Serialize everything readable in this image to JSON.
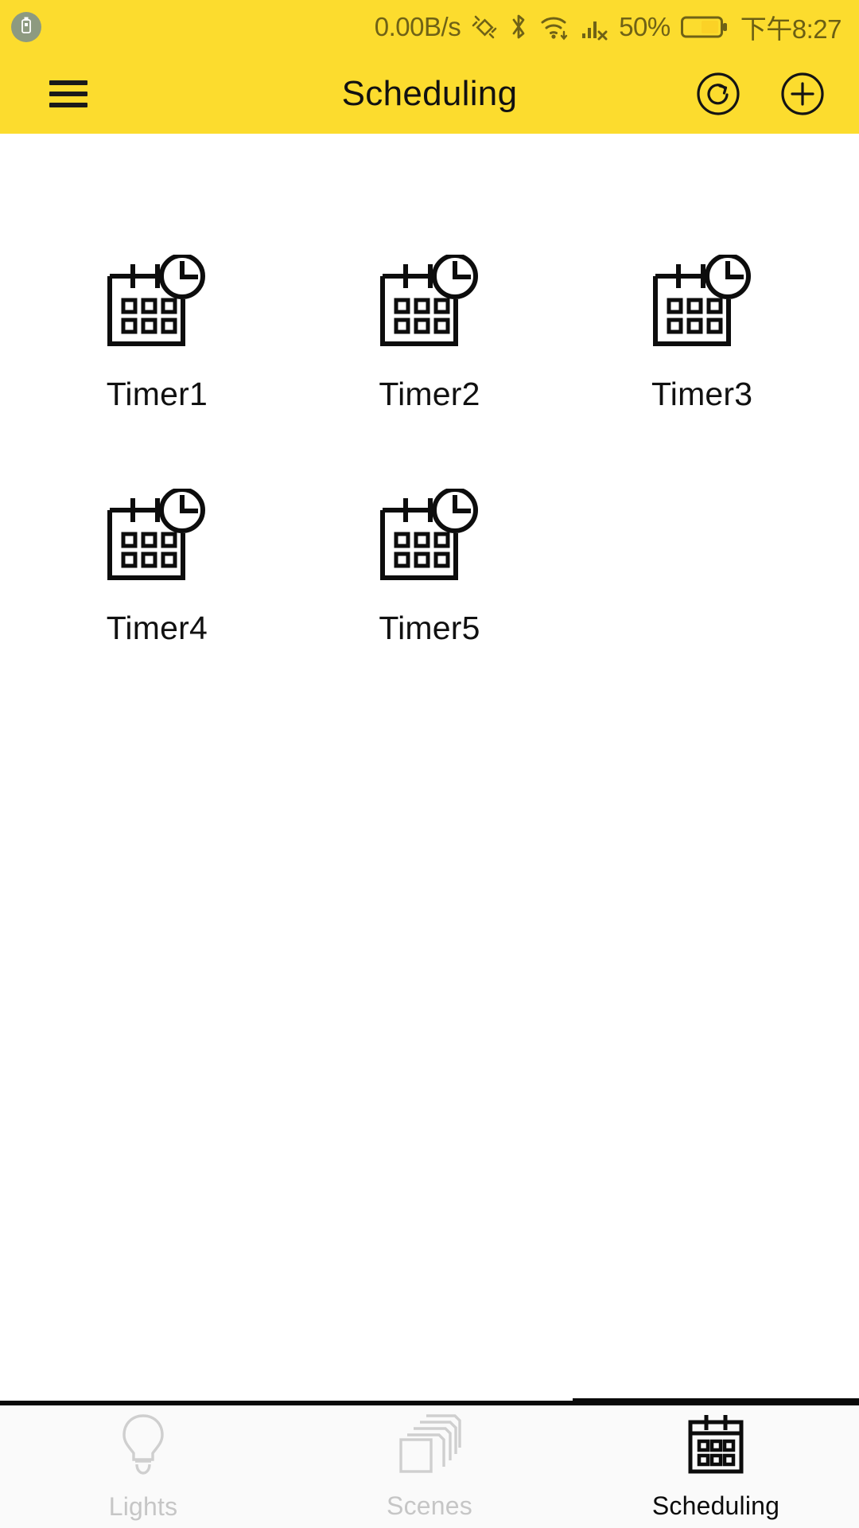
{
  "theme": {
    "accent": "#FCDC2E",
    "status_text": "#6f6216",
    "content_bg": "#ffffff",
    "nav_bg": "#fafafa",
    "nav_inactive": "#c6c6c6",
    "nav_active": "#0c0c0c",
    "icon_stroke": "#111111"
  },
  "status_bar": {
    "usb_icon": "usb-debug-icon",
    "network_speed": "0.00B/s",
    "vibrate_icon": "vibrate-icon",
    "bluetooth_icon": "bluetooth-icon",
    "wifi_icon": "wifi-icon",
    "signal_icon": "no-sim-signal-icon",
    "battery_percent": "50%",
    "battery_icon": "battery-icon",
    "clock": "下午8:27"
  },
  "header": {
    "menu_icon": "hamburger-menu-icon",
    "title": "Scheduling",
    "refresh_icon": "refresh-icon",
    "add_icon": "add-icon"
  },
  "main": {
    "item_icon": "calendar-clock-icon",
    "timers": [
      {
        "label": "Timer1"
      },
      {
        "label": "Timer2"
      },
      {
        "label": "Timer3"
      },
      {
        "label": "Timer4"
      },
      {
        "label": "Timer5"
      }
    ]
  },
  "bottom_nav": {
    "items": [
      {
        "label": "Lights",
        "icon": "lightbulb-icon",
        "active": false
      },
      {
        "label": "Scenes",
        "icon": "layers-icon",
        "active": false
      },
      {
        "label": "Scheduling",
        "icon": "calendar-icon",
        "active": true
      }
    ]
  }
}
